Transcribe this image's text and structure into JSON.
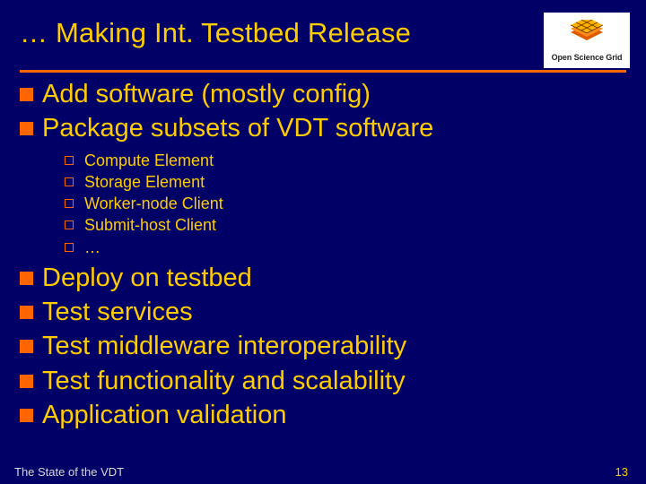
{
  "title": "… Making Int. Testbed Release",
  "logo": {
    "label": "Open Science Grid",
    "icon_name": "osg-grid-icon",
    "colors": {
      "top": "#ffb300",
      "mid": "#ff8c1a",
      "bot": "#e05a00"
    }
  },
  "rule_color": "#ff6600",
  "bullets_before": [
    "Add software (mostly config)",
    "Package subsets of VDT software"
  ],
  "sub_bullets": [
    "Compute Element",
    "Storage Element",
    "Worker-node Client",
    "Submit-host Client",
    "…"
  ],
  "bullets_after": [
    "Deploy on testbed",
    "Test services",
    "Test middleware interoperability",
    "Test functionality and scalability",
    "Application validation"
  ],
  "footer": {
    "left": "The State of the VDT",
    "page": "13"
  }
}
